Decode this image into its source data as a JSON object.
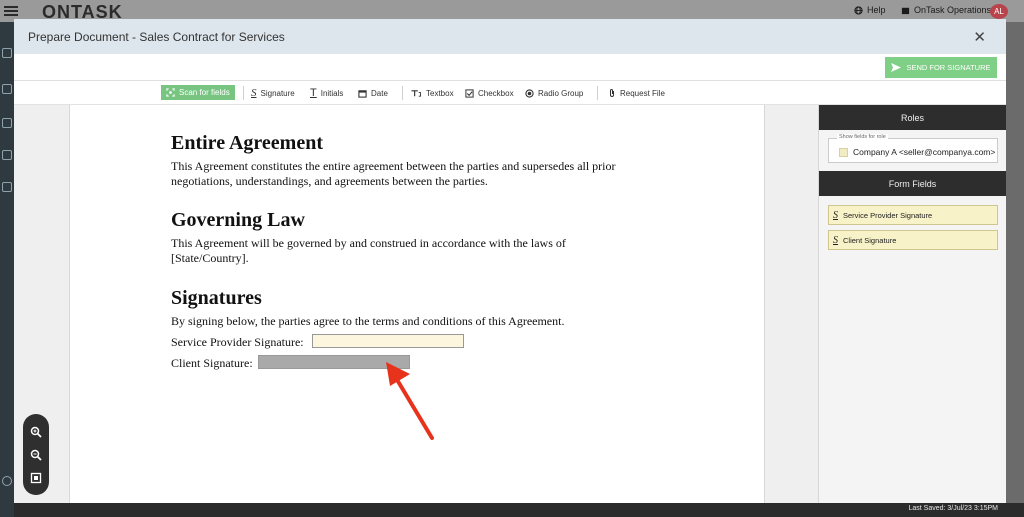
{
  "app": {
    "logo": "ONTASK",
    "help_label": "Help",
    "org_label": "OnTask Operations",
    "avatar_initials": "AL",
    "last_saved": "Last Saved: 3/Jul/23 3:15PM"
  },
  "modal": {
    "title": "Prepare Document - Sales Contract for Services",
    "close_glyph": "✕",
    "send_label": "SEND FOR SIGNATURE"
  },
  "toolbar": {
    "scan": "Scan for fields",
    "signature": "Signature",
    "initials": "Initials",
    "date": "Date",
    "textbox": "Textbox",
    "checkbox": "Checkbox",
    "radio_group": "Radio Group",
    "request_file": "Request File"
  },
  "document": {
    "entire_heading": "Entire Agreement",
    "entire_line1": "This Agreement constitutes the entire agreement between the parties and supersedes all prior",
    "entire_line2": "negotiations, understandings, and agreements between the parties.",
    "law_heading": "Governing Law",
    "law_line1": "This Agreement will be governed by and construed in accordance with the laws of",
    "law_line2": "[State/Country].",
    "sig_heading": "Signatures",
    "sig_intro": "By signing below, the parties agree to the terms and conditions of this Agreement.",
    "provider_label": "Service Provider Signature:",
    "client_label": "Client Signature:"
  },
  "right_panel": {
    "roles_heading": "Roles",
    "role_field_label": "Show fields for role",
    "role_value": "Company A <seller@companya.com>",
    "form_fields_heading": "Form Fields",
    "fields": [
      {
        "label": "Service Provider Signature"
      },
      {
        "label": "Client Signature"
      }
    ]
  },
  "colors": {
    "accent_green": "#7fcf87",
    "arrow_red": "#e8331c",
    "field_yellow": "#f7f2c8"
  }
}
